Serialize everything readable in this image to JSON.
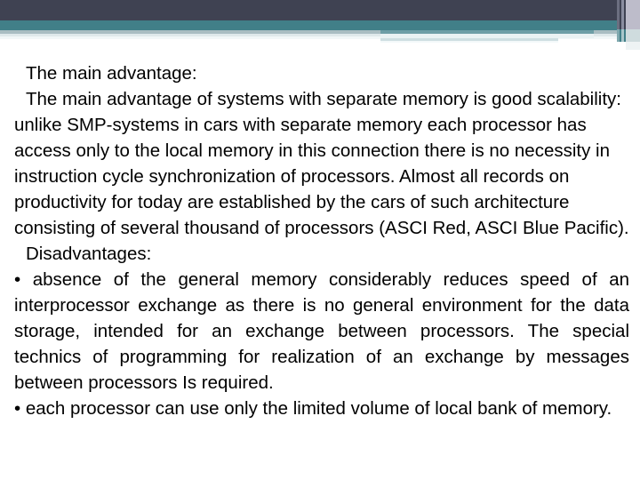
{
  "slide": {
    "type": "presentation-slide",
    "colors": {
      "band_dark": "#3f4252",
      "band_teal": "#417f88",
      "band_pale": "#a9bdc2",
      "stripe_lavender": "#bdbcca",
      "text": "#000000",
      "background": "#ffffff"
    },
    "header": {
      "name": "decorative-banner",
      "has_title_text": false
    },
    "content": {
      "heading_advantage": "The main advantage:",
      "paragraph_advantage": "The main advantage of systems with separate memory is good scalability: unlike SMP-systems in cars with separate memory each processor has access only to the local memory in this connection there is no necessity in instruction cycle synchronization of processors. Almost all records on productivity for today are established by the cars of such architecture consisting of several thousand of processors (ASCI Red, ASCI Blue Pacific).",
      "heading_disadvantages": "Disadvantages:",
      "bullets": [
        "• absence of the general memory considerably reduces speed of an interprocessor exchange as there is no general environment for the data storage, intended for an exchange between processors. The special technics of programming for realization of an exchange by messages between processors Is required.",
        "• each processor can use only the limited volume of local bank of memory."
      ]
    }
  }
}
